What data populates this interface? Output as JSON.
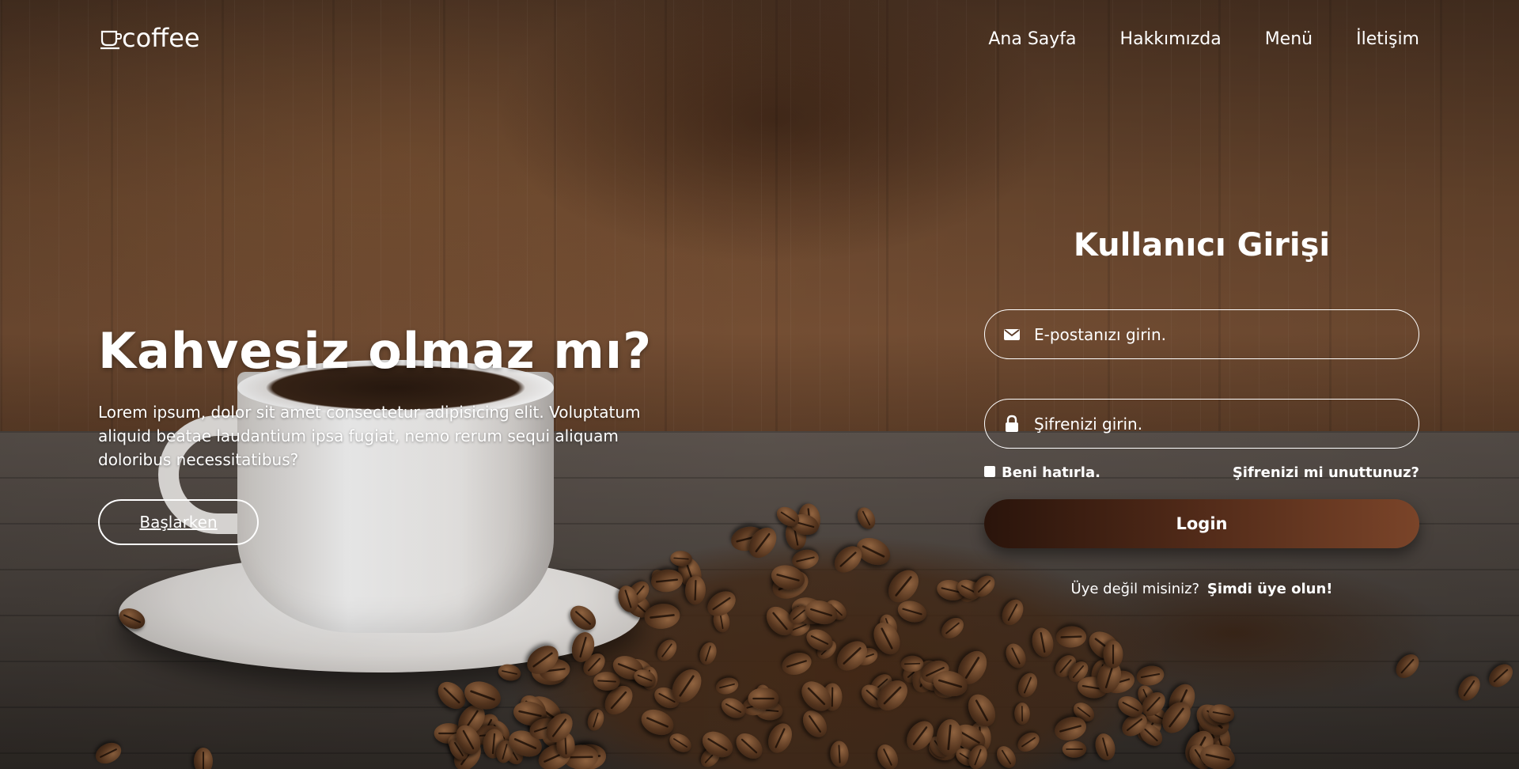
{
  "header": {
    "logo_text": "coffee",
    "logo_icon": "coffee-cup-icon",
    "nav": [
      {
        "label": "Ana Sayfa"
      },
      {
        "label": "Hakkımızda"
      },
      {
        "label": "Menü"
      },
      {
        "label": "İletişim"
      }
    ]
  },
  "hero": {
    "title": "Kahvesiz olmaz mı?",
    "text": "Lorem ipsum, dolor sit amet consectetur adipisicing elit. Voluptatum aliquid beatae laudantium ipsa fugiat, nemo rerum sequi aliquam doloribus necessitatibus?",
    "button_label": "Başlarken"
  },
  "login": {
    "title": "Kullanıcı Girişi",
    "email_placeholder": "E-postanızı girin.",
    "email_icon": "envelope-icon",
    "password_placeholder": "Şifrenizi girin.",
    "password_icon": "lock-icon",
    "remember_label": "Beni hatırla.",
    "forgot_label": "Şifrenizi mi unuttunuz?",
    "button_label": "Login",
    "register_text": "Üye değil misiniz?",
    "register_link": "Şimdi üye olun!"
  },
  "colors": {
    "login_button_start": "#2a140b",
    "login_button_end": "#7a4429",
    "text": "#ffffff"
  }
}
